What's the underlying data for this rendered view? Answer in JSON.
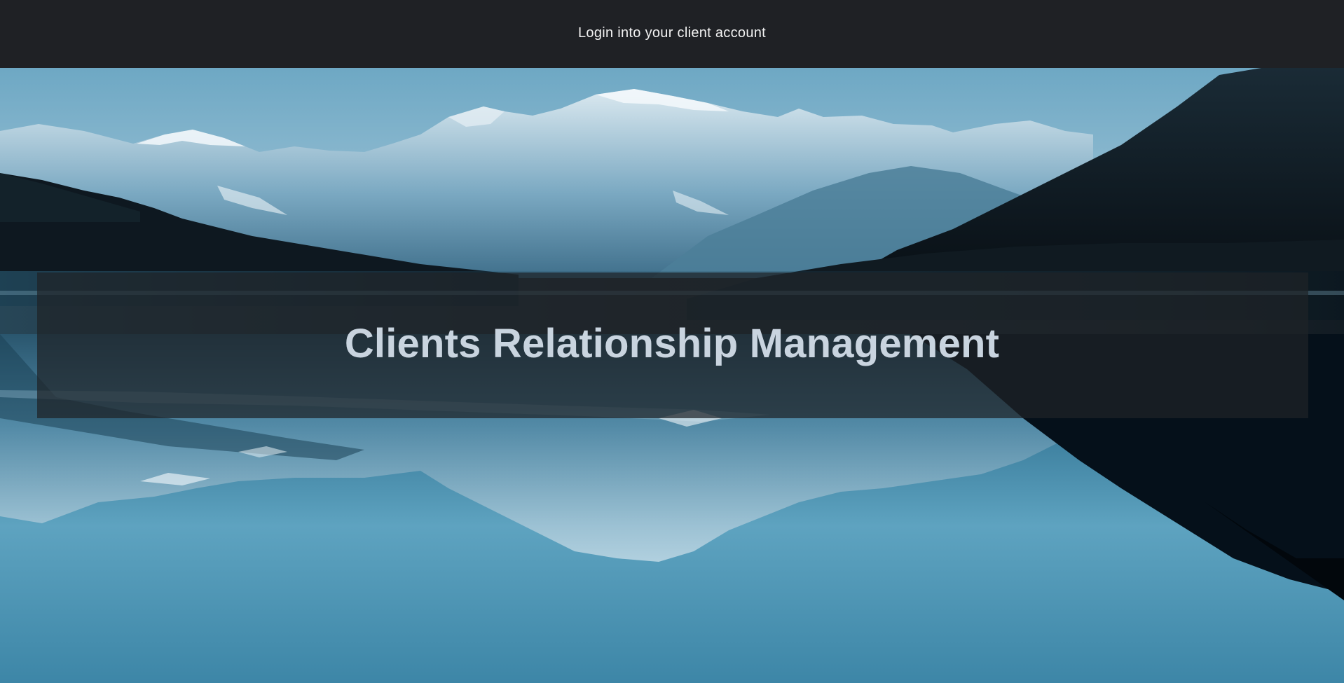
{
  "nav": {
    "login_label": "Login into your client account"
  },
  "hero": {
    "title": "Clients Relationship Management",
    "background_image": "mountain-lake-reflection",
    "colors": {
      "nav_background": "#1f2125",
      "title_text": "#c9d4df",
      "sky_top": "#6ea8c4",
      "water": "#3d86a7"
    }
  }
}
